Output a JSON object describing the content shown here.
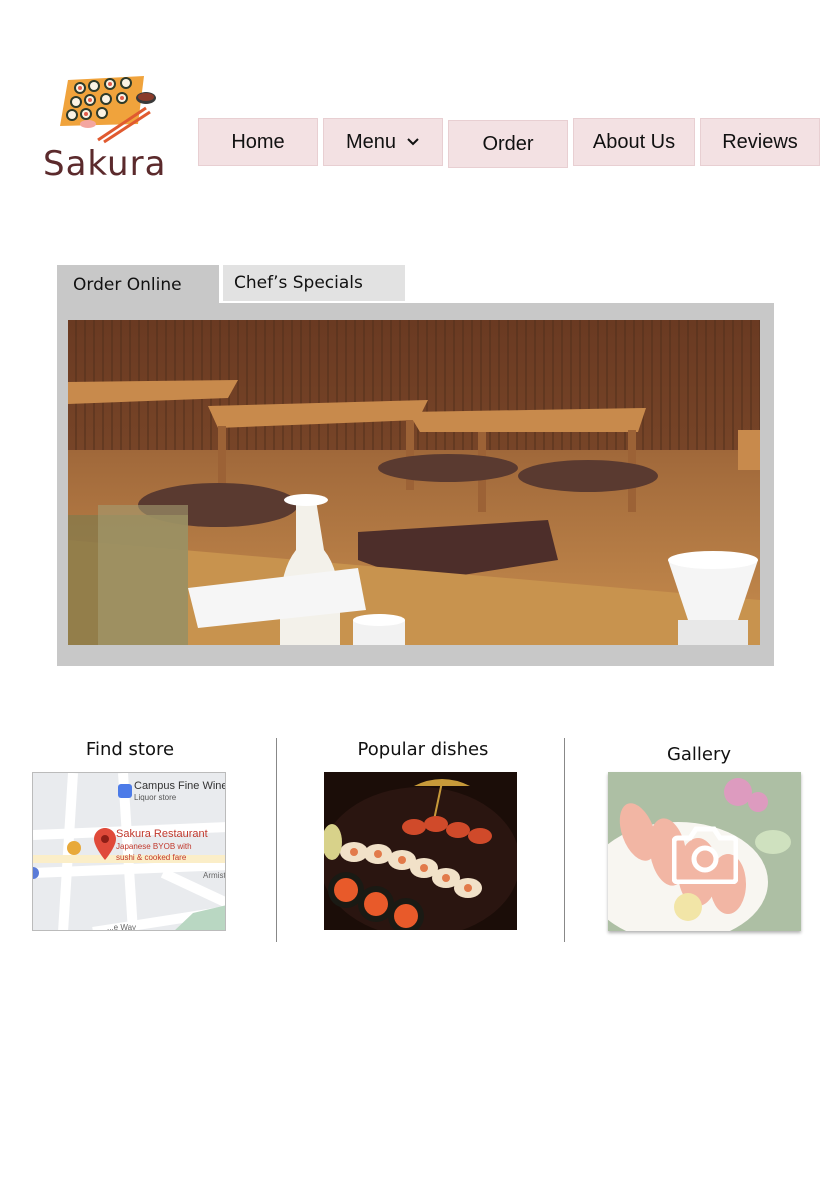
{
  "brand": {
    "name": "Sakura"
  },
  "nav": {
    "home": "Home",
    "menu": "Menu",
    "order": "Order",
    "about": "About Us",
    "reviews": "Reviews"
  },
  "tabs": {
    "order_online": "Order Online",
    "chefs_specials": "Chef’s Specials"
  },
  "sections": {
    "find_store": "Find store",
    "popular_dishes": "Popular dishes",
    "gallery": "Gallery"
  },
  "map": {
    "place1_name": "Campus Fine Wines",
    "place1_type": "Liquor store",
    "place2_name": "Sakura Restaurant",
    "place2_desc1": "Japanese BYOB with",
    "place2_desc2": "sushi & cooked fare",
    "street1": "Armist",
    "street2": "...e Way"
  },
  "colors": {
    "brand": "#5b2a2c",
    "nav_bg": "#f3e1e3",
    "panel_bg": "#c8c8c8",
    "tab_inactive": "#e2e2e2"
  },
  "icons": [
    "sushi-logo-icon",
    "chevron-down-icon",
    "camera-icon",
    "map-pin-icon",
    "shopping-bag-icon",
    "cafe-icon"
  ]
}
